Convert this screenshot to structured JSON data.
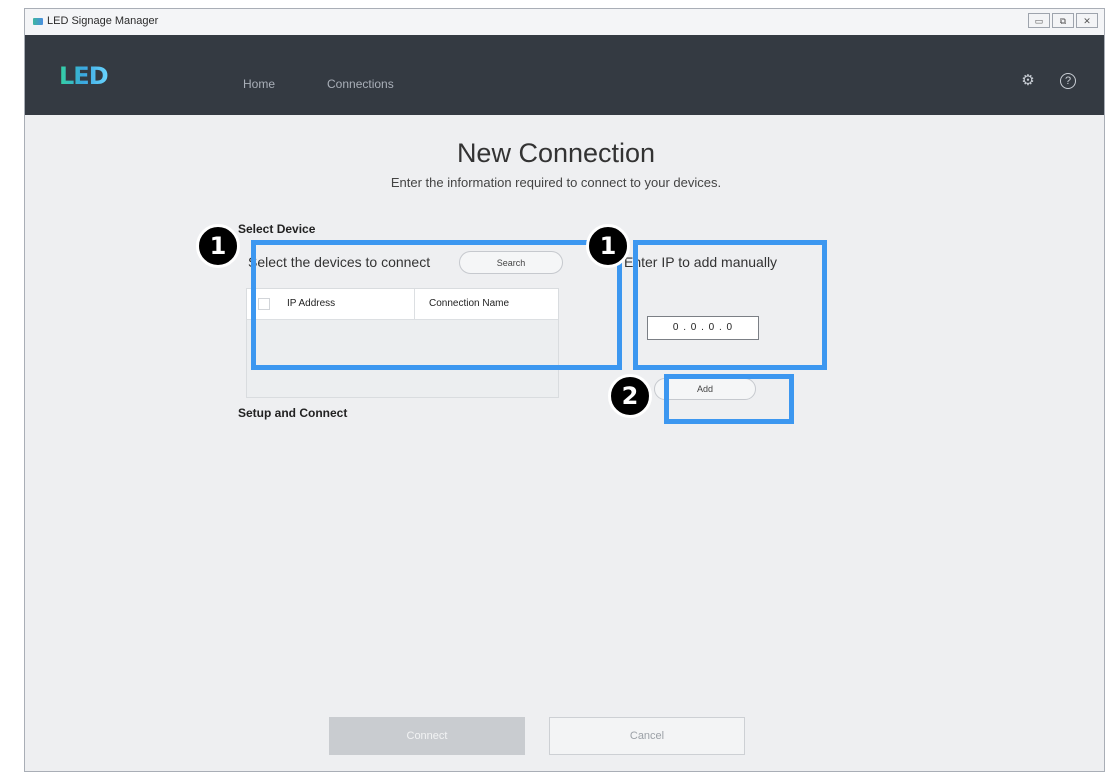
{
  "window": {
    "title": "LED Signage Manager",
    "controls": [
      "▭",
      "⧉",
      "✕"
    ]
  },
  "navbar": {
    "logo": "LED",
    "items": [
      "Home",
      "Connections"
    ],
    "icons": [
      "gear-icon",
      "help-icon"
    ]
  },
  "page": {
    "title": "New Connection",
    "subtitle": "Enter the information required to connect to your devices."
  },
  "select_device": {
    "section_label": "Select Device",
    "panel_title": "Select the devices to connect",
    "search_label": "Search",
    "columns": [
      "IP Address",
      "Connection Name"
    ],
    "rows": []
  },
  "manual_ip": {
    "panel_title": "Enter IP to add manually",
    "ip_value": "0 . 0 . 0 . 0",
    "add_label": "Add"
  },
  "setup": {
    "section_label": "Setup and Connect"
  },
  "footer": {
    "connect_label": "Connect",
    "cancel_label": "Cancel"
  },
  "annotations": {
    "badge_1": "1",
    "badge_2": "1",
    "badge_3": "2",
    "highlight_color": "#3c97f0"
  }
}
